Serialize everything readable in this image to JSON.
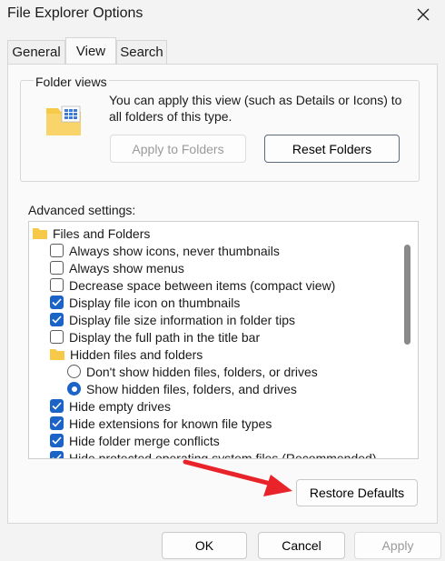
{
  "window": {
    "title": "File Explorer Options"
  },
  "tabs": [
    {
      "label": "General"
    },
    {
      "label": "View"
    },
    {
      "label": "Search"
    }
  ],
  "folder_views": {
    "label": "Folder views",
    "description": "You can apply this view (such as Details or Icons) to all folders of this type.",
    "apply_button": "Apply to Folders",
    "reset_button": "Reset Folders"
  },
  "advanced": {
    "label": "Advanced settings:",
    "items": [
      {
        "kind": "folder",
        "label": "Files and Folders"
      },
      {
        "kind": "checkbox",
        "checked": false,
        "label": "Always show icons, never thumbnails"
      },
      {
        "kind": "checkbox",
        "checked": false,
        "label": "Always show menus"
      },
      {
        "kind": "checkbox",
        "checked": false,
        "label": "Decrease space between items (compact view)"
      },
      {
        "kind": "checkbox",
        "checked": true,
        "label": "Display file icon on thumbnails"
      },
      {
        "kind": "checkbox",
        "checked": true,
        "label": "Display file size information in folder tips"
      },
      {
        "kind": "checkbox",
        "checked": false,
        "label": "Display the full path in the title bar"
      },
      {
        "kind": "folder",
        "label": "Hidden files and folders"
      },
      {
        "kind": "radio",
        "checked": false,
        "label": "Don't show hidden files, folders, or drives"
      },
      {
        "kind": "radio",
        "checked": true,
        "label": "Show hidden files, folders, and drives"
      },
      {
        "kind": "checkbox",
        "checked": true,
        "label": "Hide empty drives"
      },
      {
        "kind": "checkbox",
        "checked": true,
        "label": "Hide extensions for known file types"
      },
      {
        "kind": "checkbox",
        "checked": true,
        "label": "Hide folder merge conflicts"
      },
      {
        "kind": "checkbox",
        "checked": true,
        "label": "Hide protected operating system files (Recommended)"
      }
    ]
  },
  "restore_button": "Restore Defaults",
  "footer": {
    "ok": "OK",
    "cancel": "Cancel",
    "apply": "Apply"
  },
  "colors": {
    "accent": "#1b63c6",
    "arrow": "#e8232a",
    "folder": "#f7c948"
  }
}
